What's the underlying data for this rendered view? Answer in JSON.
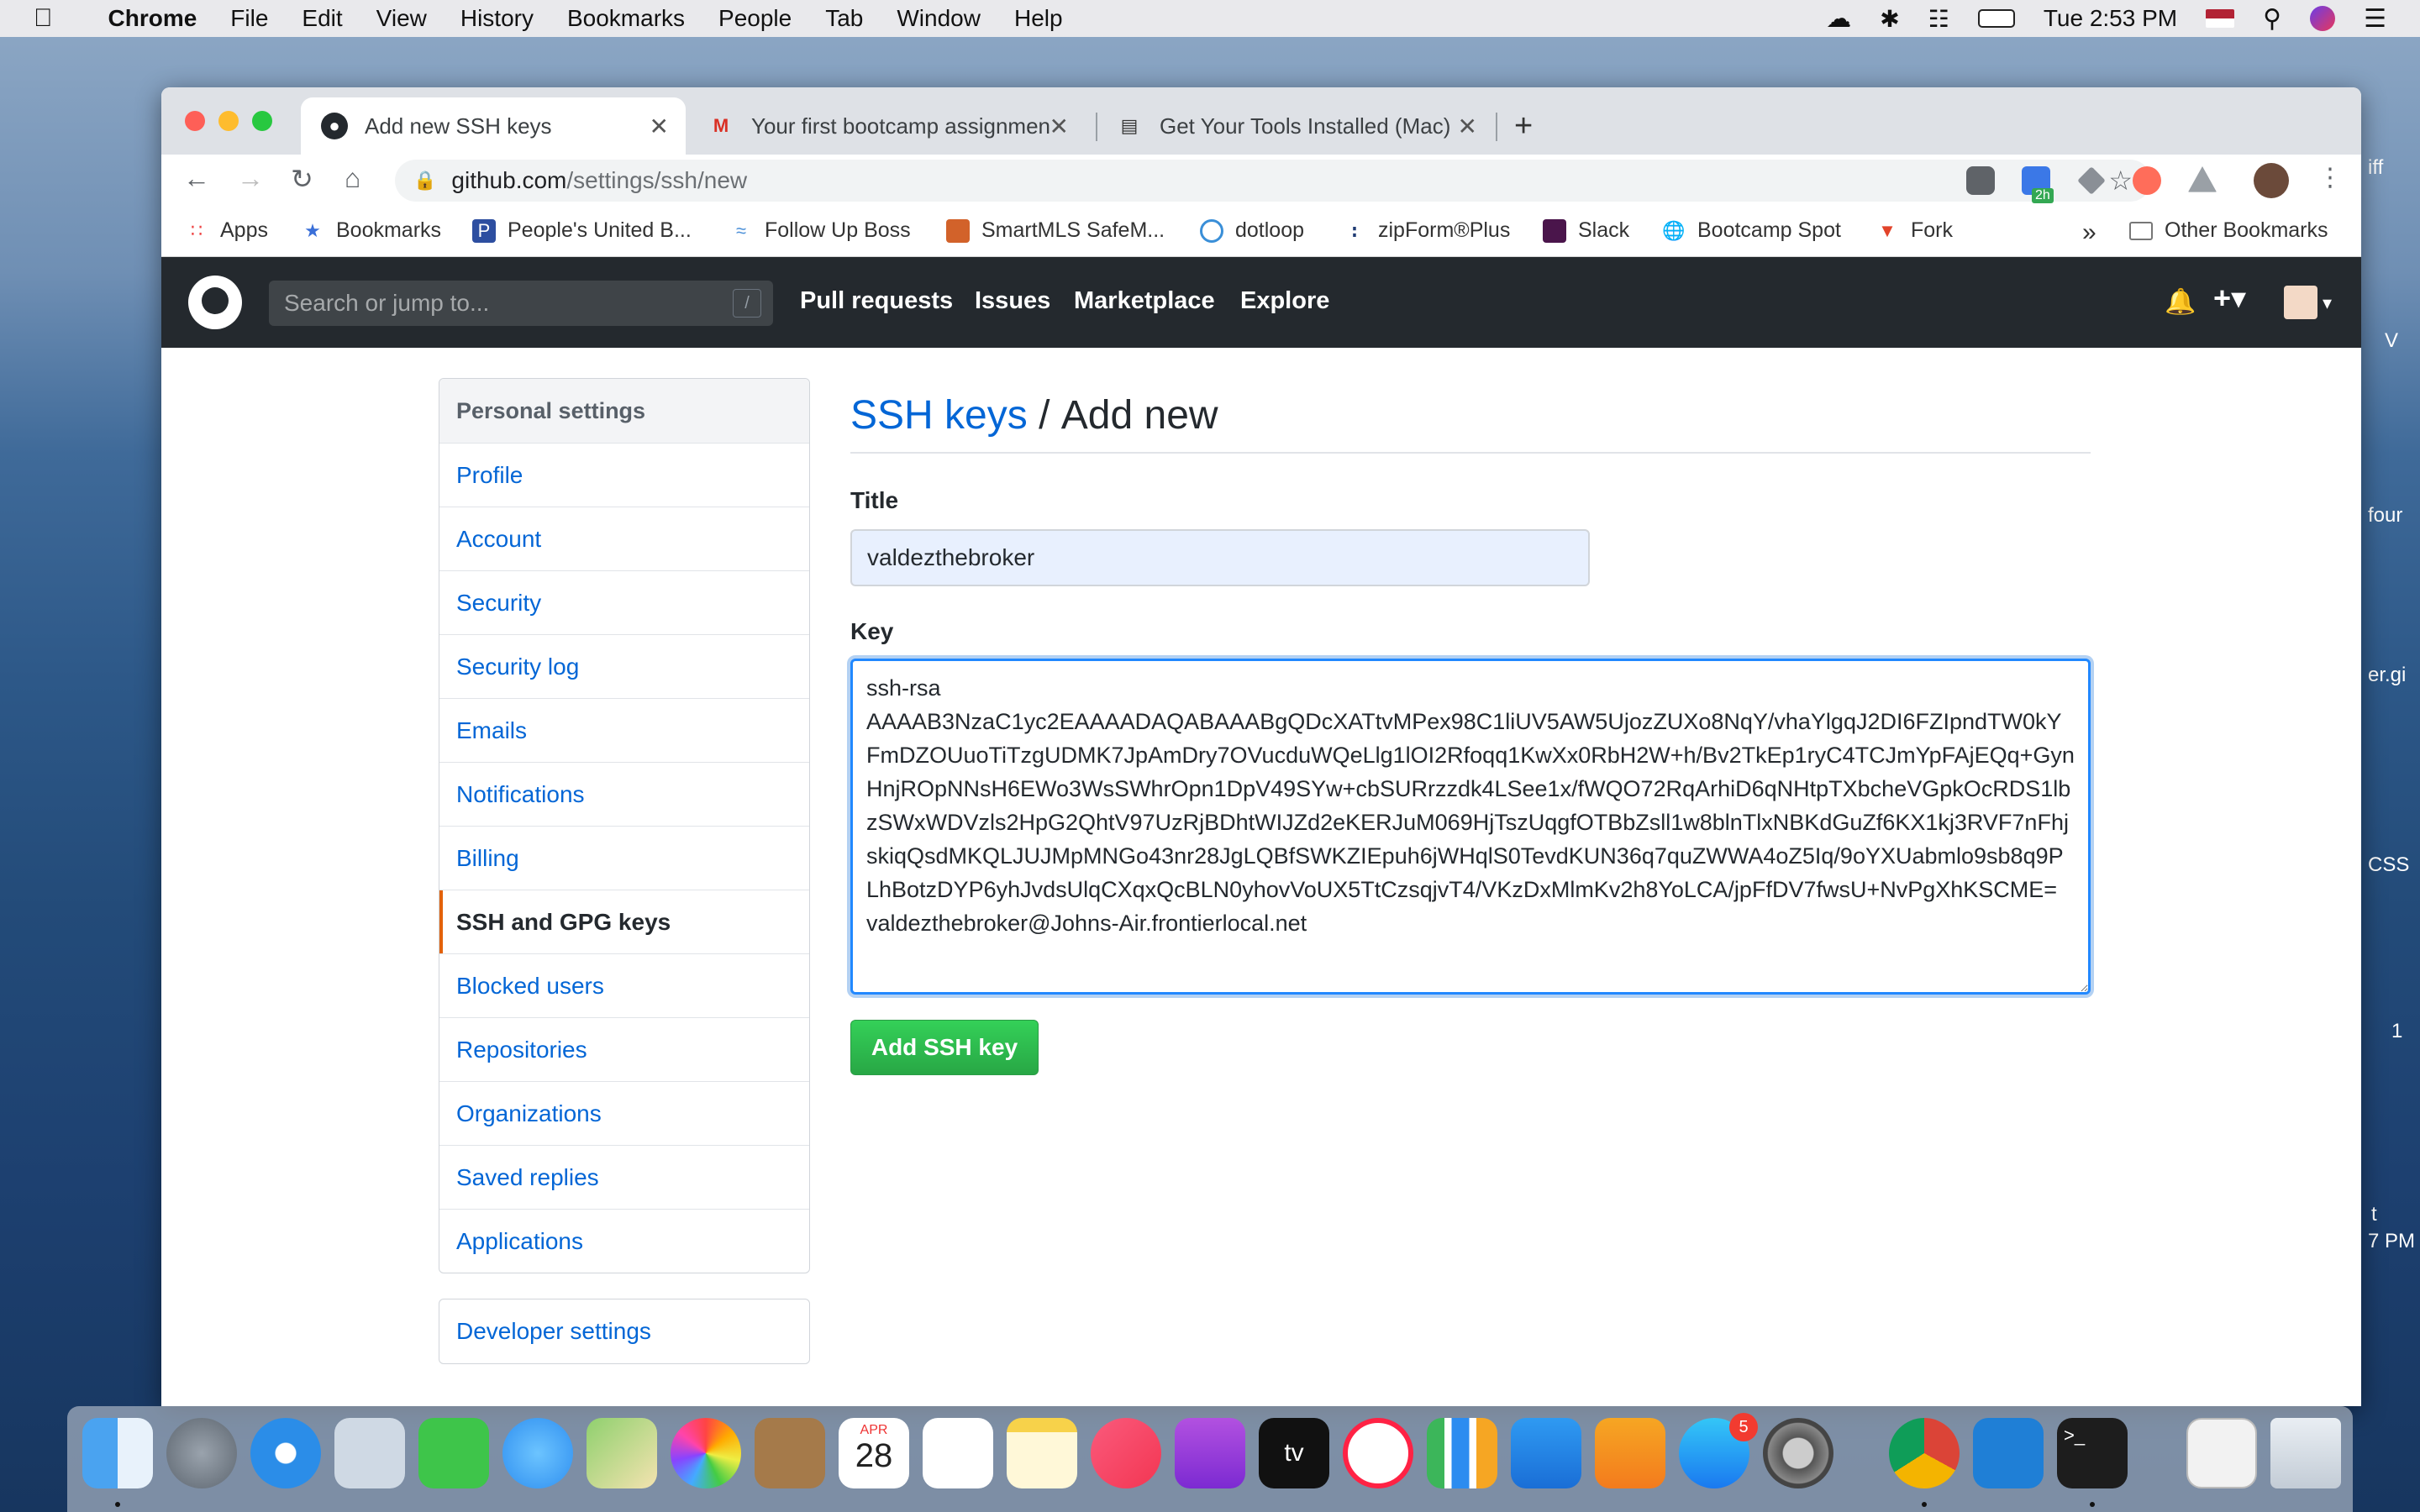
{
  "menubar": {
    "app": "Chrome",
    "items": [
      "File",
      "Edit",
      "View",
      "History",
      "Bookmarks",
      "People",
      "Tab",
      "Window",
      "Help"
    ],
    "clock": "Tue 2:53 PM"
  },
  "desktop_fragments": [
    "iff",
    "V",
    "four",
    "er.gi",
    "CSS",
    "1",
    "t",
    "7 PM"
  ],
  "tabs": [
    {
      "title": "Add new SSH keys",
      "active": true
    },
    {
      "title": "Your first bootcamp assignmen",
      "active": false
    },
    {
      "title": "Get Your Tools Installed (Mac)",
      "active": false
    }
  ],
  "new_tab": "+",
  "address": {
    "host": "github.com",
    "path": "/settings/ssh/new"
  },
  "extensions": {
    "badge": "2h"
  },
  "bookmarks": [
    {
      "label": "Apps",
      "icon": "apps-grid-icon",
      "color": "#e44"
    },
    {
      "label": "Bookmarks",
      "icon": "star-icon",
      "color": "#3a6fd8"
    },
    {
      "label": "People's United B...",
      "icon": "peoples-united-icon",
      "color": "#2d4ea0"
    },
    {
      "label": "Follow Up Boss",
      "icon": "follow-up-boss-icon",
      "color": "#4a8fd8"
    },
    {
      "label": "SmartMLS SafeM...",
      "icon": "smartmls-icon",
      "color": "#d2622a"
    },
    {
      "label": "dotloop",
      "icon": "dotloop-icon",
      "color": "#3a8fd8"
    },
    {
      "label": "zipForm®Plus",
      "icon": "zipform-icon",
      "color": "#1f3b73"
    },
    {
      "label": "Slack",
      "icon": "slack-icon",
      "color": "#4a154b"
    },
    {
      "label": "Bootcamp Spot",
      "icon": "globe-icon",
      "color": "#555"
    },
    {
      "label": "Fork",
      "icon": "gitlab-icon",
      "color": "#e2432a"
    }
  ],
  "bookmarks_overflow": "»",
  "other_bookmarks": "Other Bookmarks",
  "github": {
    "search_placeholder": "Search or jump to...",
    "search_key": "/",
    "nav": [
      "Pull requests",
      "Issues",
      "Marketplace",
      "Explore"
    ]
  },
  "sidebar": {
    "heading": "Personal settings",
    "items": [
      "Profile",
      "Account",
      "Security",
      "Security log",
      "Emails",
      "Notifications",
      "Billing",
      "SSH and GPG keys",
      "Blocked users",
      "Repositories",
      "Organizations",
      "Saved replies",
      "Applications"
    ],
    "selected": "SSH and GPG keys",
    "developer": "Developer settings"
  },
  "page": {
    "crumb_link": "SSH keys",
    "crumb_sep": " / ",
    "crumb_current": "Add new",
    "title_label": "Title",
    "title_value": "valdezthebroker",
    "key_label": "Key",
    "key_value": "ssh-rsa\nAAAAB3NzaC1yc2EAAAADAQABAAABgQDcXATtvMPex98C1liUV5AW5UjozZUXo8NqY/vhaYlgqJ2DI6FZIpndTW0kYFmDZOUuoTiTzgUDMK7JpAmDry7OVucduWQeLlg1lOI2Rfoqq1KwXx0RbH2W+h/Bv2TkEp1ryC4TCJmYpFAjEQq+GynHnjROpNNsH6EWo3WsSWhrOpn1DpV49SYw+cbSURrzzdk4LSee1x/fWQO72RqArhiD6qNHtpTXbcheVGpkOcRDS1lbzSWxWDVzls2HpG2QhtV97UzRjBDhtWIJZd2eKERJuM069HjTszUqgfOTBbZsll1w8blnTlxNBKdGuZf6KX1kj3RVF7nFhjskiqQsdMKQLJUJMpMNGo43nr28JgLQBfSWKZIEpuh6jWHqlS0TevdKUN36q7quZWWA4oZ5Iq/9oYXUabmlo9sb8q9PLhBotzDYP6yhJvdsUlqCXqxQcBLN0yhovVoUX5TtCzsqjvT4/VKzDxMlmKv2h8YoLCA/jpFfDV7fwsU+NvPgXhKSCME= valdezthebroker@Johns-Air.frontierlocal.net",
    "submit": "Add SSH key"
  },
  "dock": {
    "calendar_month": "APR",
    "calendar_day": "28",
    "appstore_badge": "5",
    "appletv_label": "tv"
  }
}
